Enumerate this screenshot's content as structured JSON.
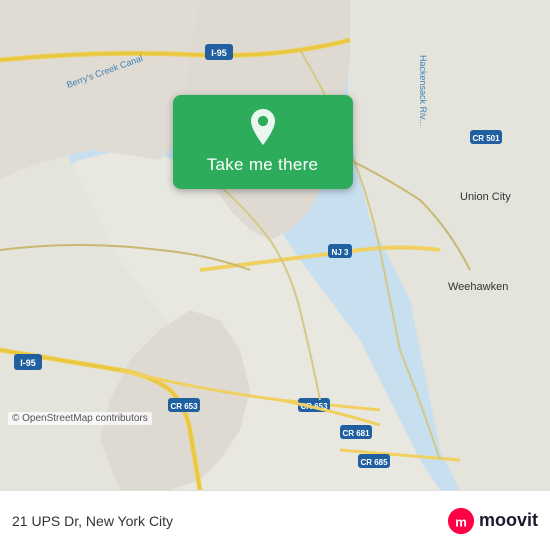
{
  "map": {
    "attribution": "© OpenStreetMap contributors",
    "background_color": "#e8e0d8"
  },
  "button": {
    "label": "Take me there",
    "pin_icon": "location-pin"
  },
  "bottom_bar": {
    "address": "21 UPS Dr, New York City",
    "logo_name": "moovit"
  }
}
